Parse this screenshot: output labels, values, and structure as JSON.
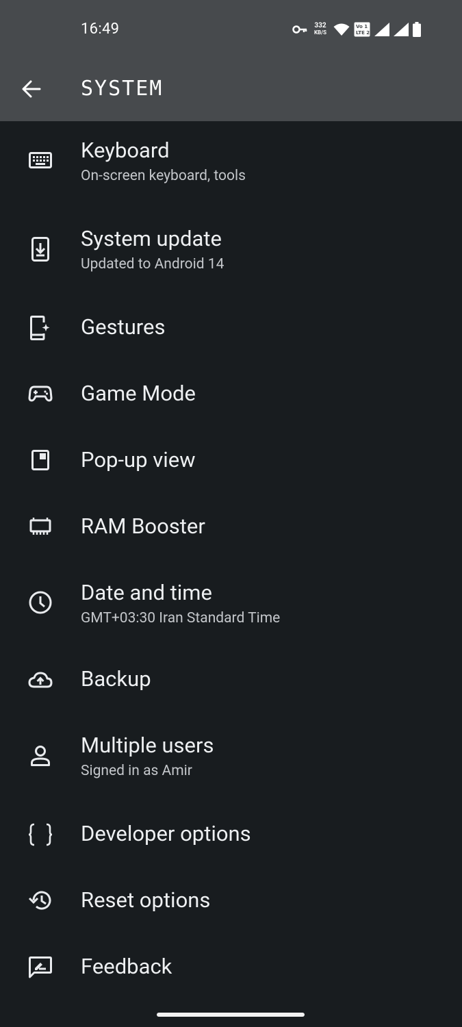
{
  "status_bar": {
    "time": "16:49",
    "speed_value": "332",
    "speed_unit": "KB/S",
    "icons": [
      "vpn-key-icon",
      "wifi-icon",
      "volte-icon",
      "signal-icon",
      "signal-icon",
      "battery-icon"
    ]
  },
  "header": {
    "title": "SYSTEM",
    "back_icon": "arrow-back-icon"
  },
  "items": [
    {
      "label": "Keyboard",
      "sub": "On-screen keyboard, tools",
      "icon": "keyboard-icon"
    },
    {
      "label": "System update",
      "sub": "Updated to Android 14",
      "icon": "system-update-icon"
    },
    {
      "label": "Gestures",
      "icon": "gestures-icon"
    },
    {
      "label": "Game Mode",
      "icon": "gamepad-icon"
    },
    {
      "label": "Pop-up view",
      "icon": "popup-view-icon"
    },
    {
      "label": "RAM Booster",
      "icon": "ram-icon"
    },
    {
      "label": "Date and time",
      "sub": "GMT+03:30 Iran Standard Time",
      "icon": "clock-icon"
    },
    {
      "label": "Backup",
      "icon": "cloud-upload-icon"
    },
    {
      "label": "Multiple users",
      "sub": "Signed in as Amir",
      "icon": "person-icon"
    },
    {
      "label": "Developer options",
      "icon": "braces-icon"
    },
    {
      "label": "Reset options",
      "icon": "history-icon"
    },
    {
      "label": "Feedback",
      "icon": "feedback-icon"
    }
  ]
}
